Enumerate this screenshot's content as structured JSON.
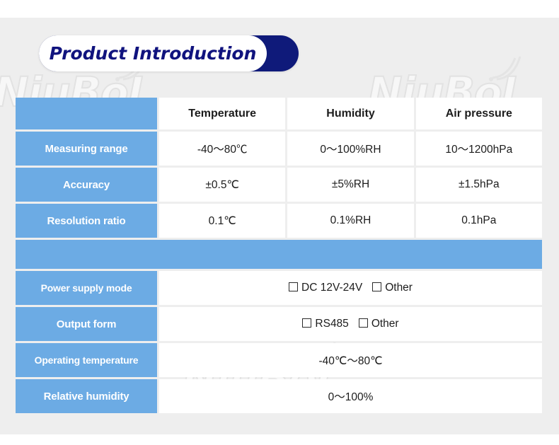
{
  "badge": {
    "title": "Product Introduction",
    "accent_color": "#10137e",
    "pill_color": "#ffffff"
  },
  "watermark": {
    "text": "NiuBoL"
  },
  "theme": {
    "label_blue": "#6cabe4",
    "page_bg": "#eeeeee",
    "cell_bg": "#ffffff"
  },
  "spec_table": {
    "headers": [
      "",
      "Temperature",
      "Humidity",
      "Air pressure"
    ],
    "rows": [
      {
        "label": "Measuring range",
        "values": [
          "-40～80℃",
          "0～100%RH",
          "10～1200hPa"
        ]
      },
      {
        "label": "Accuracy",
        "values": [
          "±0.5℃",
          "±5%RH",
          "±1.5hPa"
        ]
      },
      {
        "label": "Resolution ratio",
        "values": [
          "0.1℃",
          "0.1%RH",
          "0.1hPa"
        ]
      }
    ]
  },
  "general_table": {
    "rows": [
      {
        "label": "Power supply mode",
        "type": "checkbox",
        "options": [
          "DC 12V-24V",
          "Other"
        ]
      },
      {
        "label": "Output form",
        "type": "checkbox",
        "options": [
          "RS485",
          "Other"
        ]
      },
      {
        "label": "Operating temperature",
        "type": "text",
        "value": "-40℃～80℃"
      },
      {
        "label": "Relative humidity",
        "type": "text",
        "value": "0～100%"
      }
    ]
  }
}
